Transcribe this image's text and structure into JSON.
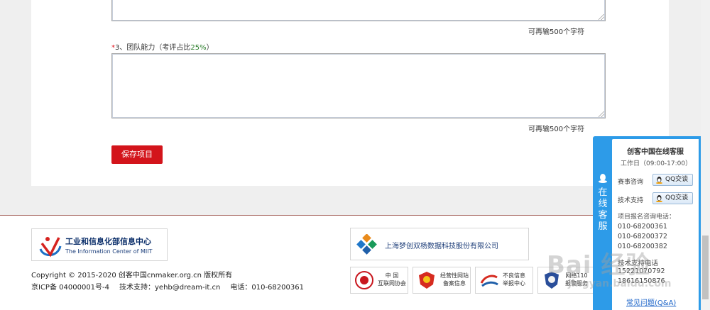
{
  "form": {
    "counter_1": "可再输500个字符",
    "question_3": {
      "required_mark": "*",
      "label": "3、团队能力（考评占比",
      "percent": "25%",
      "suffix": "）"
    },
    "counter_2": "可再输500个字符",
    "save_button": "保存项目"
  },
  "footer": {
    "miit_logo": {
      "cn": "工业和信息化部信息中心",
      "en": "The Information Center of  MIIT"
    },
    "copyright": "Copyright © 2015-2020  创客中国cnmaker.org.cn 版权所有",
    "icp": "京ICP备 04000001号-4",
    "support": "技术支持：yehb@dream-it.cn",
    "phone": "电话：010-68200361",
    "partner": "上海梦创双杨数据科技股份有限公司",
    "badges": [
      {
        "line1": "中  国",
        "line2": "互联网协会"
      },
      {
        "line1": "经营性网站",
        "line2": "备案信息"
      },
      {
        "line1": "不良信息",
        "line2": "举报中心"
      },
      {
        "line1": "网络110",
        "line2": "报警服务"
      }
    ]
  },
  "customer_service": {
    "tab_label": "在线客服",
    "title": "创客中国在线客服",
    "hours": "工作日（09:00-17:00）",
    "rows": [
      {
        "label": "赛事咨询",
        "button": "QQ交谈"
      },
      {
        "label": "技术支持",
        "button": "QQ交谈"
      }
    ],
    "phone_note": "项目报名咨询电话：",
    "phones": [
      "010-68200361",
      "010-68200372",
      "010-68200382"
    ],
    "tech_phone_label": "技术支持电话",
    "tech_phones": [
      "15221070792",
      "18616150876"
    ],
    "faq_link": "常见问题(Q&A)"
  },
  "watermark": {
    "main": "Bai 经验",
    "sub": "jingyan.baidu.com"
  },
  "colors": {
    "save_button": "#d3141b",
    "service_panel": "#2d9be8",
    "percent": "#2a7d2a",
    "link": "#1a63c8"
  }
}
